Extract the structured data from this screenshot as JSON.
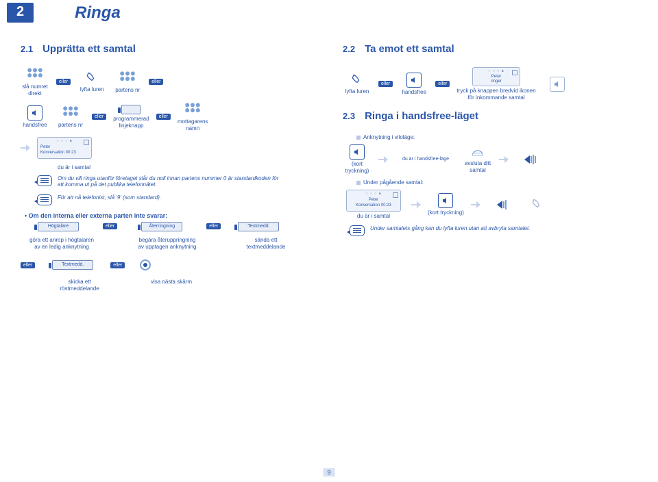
{
  "chapter": {
    "num": "2",
    "title": "Ringa"
  },
  "eller": "eller",
  "s21": {
    "num": "2.1",
    "title": "Upprätta ett samtal",
    "row1": {
      "dial_direct": "slå numret\ndirekt",
      "lift_handset": "lyfta luren",
      "partner_nr": "partens nr"
    },
    "row2": {
      "handsfree": "handsfree",
      "partner_nr": "partens nr",
      "prog_key": "programmerad\nlinjeknapp",
      "recip_name": "mottagarens\nnamn"
    },
    "screen": {
      "name": "Peter",
      "status": "Konversation 00:23"
    },
    "in_call": "du är i samtal",
    "tip1": "Om du vill ringa utanför företaget slår du noll innan partens nummer 0 är standardkoden för att komma ut på det publika telefonnätet.",
    "tip2": "För att nå telefonist, slå '9' (som standard).",
    "noanswer_head": "Om den interna eller externa parten inte svarar:",
    "sk_hogtalare": "Högtalare",
    "sk_aterring": "Återringning",
    "sk_textmedd": "Textmedd.",
    "cap_hogtalare": "göra ett anrop i högtalaren\nav en ledig anknytning",
    "cap_aterring": "begära återuppringning\nav upptagen anknytning",
    "cap_textmedd": "sända ett\ntextmeddelande",
    "sk_textmedd2": "Textmedd.",
    "cap_voicemail": "skicka ett\nröstmeddelande",
    "cap_nextscreen": "visa nästa skärm"
  },
  "s22": {
    "num": "2.2",
    "title": "Ta emot ett samtal",
    "lift": "lyfta luren",
    "hf": "handsfree",
    "screen_name": "Peter\nringer",
    "press_icon": "tryck på knappen bredvid ikonen\nför inkommande samtal"
  },
  "s23": {
    "num": "2.3",
    "title": "Ringa i handsfree-läget",
    "idle": "Anknytning i viloläge:",
    "short_press": "(kort\ntryckning)",
    "hf_mode": "du är i handsfree-läge",
    "end_call": "avsluta ditt\nsamtal",
    "during": "Under pågående samtal:",
    "screen": {
      "name": "Peter",
      "status": "Konversation 00:23"
    },
    "in_call": "du är i samtal",
    "short_press2": "(kort tryckning)",
    "tip": "Under samtalets gång kan du lyfta luren utan att avbryta samtalet."
  },
  "page_number": "9"
}
